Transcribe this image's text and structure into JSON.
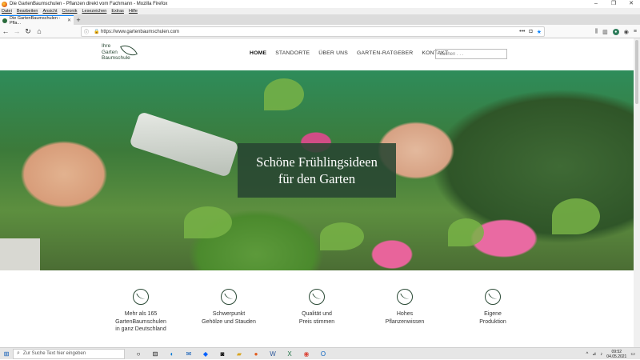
{
  "window": {
    "title": "Die GartenBaumschulen - Pflanzen direkt vom Fachmann - Mozilla Firefox",
    "controls": [
      "–",
      "❐",
      "✕"
    ]
  },
  "menu": [
    "Datei",
    "Bearbeiten",
    "Ansicht",
    "Chronik",
    "Lesezeichen",
    "Extras",
    "Hilfe"
  ],
  "tab": {
    "title": "Die GartenBaumschulen - Pfla...",
    "close": "✕",
    "new": "+"
  },
  "nav": {
    "url": "https://www.gartenbaumschulen.com",
    "more": "•••"
  },
  "site": {
    "logo_line1": "Ihre",
    "logo_line2": "Garten",
    "logo_line3": "Baumschule",
    "menu": [
      "HOME",
      "STANDORTE",
      "ÜBER UNS",
      "GARTEN-RATGEBER",
      "KONTAKT"
    ],
    "search_placeholder": "Suchen . . .",
    "hero_line1": "Schöne Frühlingsideen",
    "hero_line2": "für den Garten"
  },
  "features": [
    {
      "line1": "Mehr als 165",
      "line2": "GartenBaumschulen",
      "line3": "in ganz Deutschland"
    },
    {
      "line1": "Schwerpunkt",
      "line2": "Gehölze und Stauden",
      "line3": ""
    },
    {
      "line1": "Qualität und",
      "line2": "Preis stimmen",
      "line3": ""
    },
    {
      "line1": "Hohes",
      "line2": "Pflanzenwissen",
      "line3": ""
    },
    {
      "line1": "Eigene",
      "line2": "Produktion",
      "line3": ""
    }
  ],
  "taskbar": {
    "search_placeholder": "Zur Suche Text hier eingeben",
    "time": "09:52",
    "date": "04.05.2021"
  }
}
